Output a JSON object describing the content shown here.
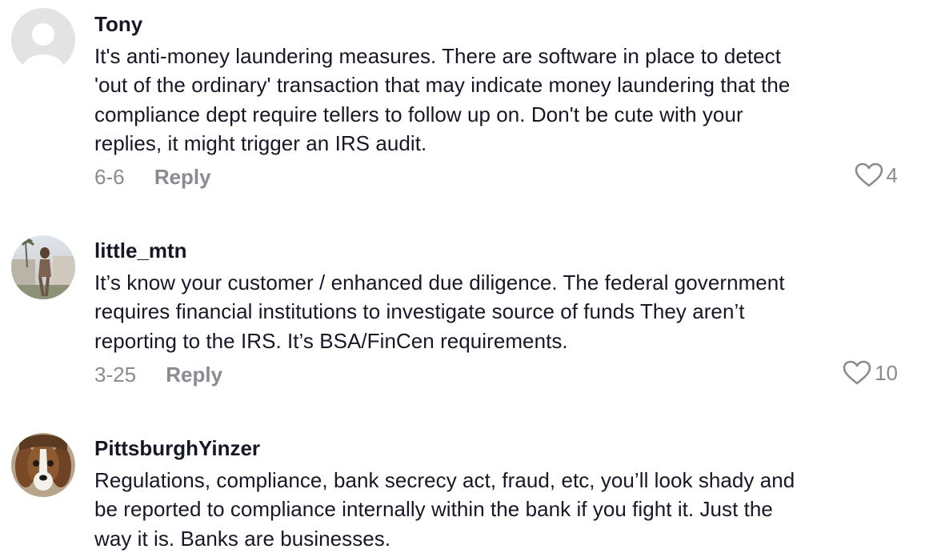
{
  "comments": [
    {
      "avatar": "default-avatar-icon",
      "username": "Tony",
      "lines": [
        "It's anti-money laundering measures. There are software in place to detect",
        "'out of the ordinary' transaction that may indicate money laundering that the",
        "compliance dept require tellers to follow up on. Don't be cute with your",
        "replies, it might trigger an IRS audit."
      ],
      "date": "6-6",
      "reply_label": "Reply",
      "likes": "4"
    },
    {
      "avatar": "user-photo-avatar",
      "username": "little_mtn",
      "lines": [
        "It’s know your customer / enhanced due diligence. The federal government",
        "requires financial institutions to investigate source of funds They aren’t",
        "reporting to the IRS. It’s BSA/FinCen requirements."
      ],
      "date": "3-25",
      "reply_label": "Reply",
      "likes": "10"
    },
    {
      "avatar": "dog-photo-avatar",
      "username": "PittsburghYinzer",
      "lines": [
        "Regulations, compliance, bank secrecy act, fraud, etc, you’ll look shady and",
        "be reported to compliance internally within the bank if you fight it. Just the",
        "way it is. Banks are businesses."
      ]
    }
  ],
  "colors": {
    "text": "#161823",
    "muted": "#8a8b91",
    "avatar_default_bg": "#e3e3e4"
  }
}
